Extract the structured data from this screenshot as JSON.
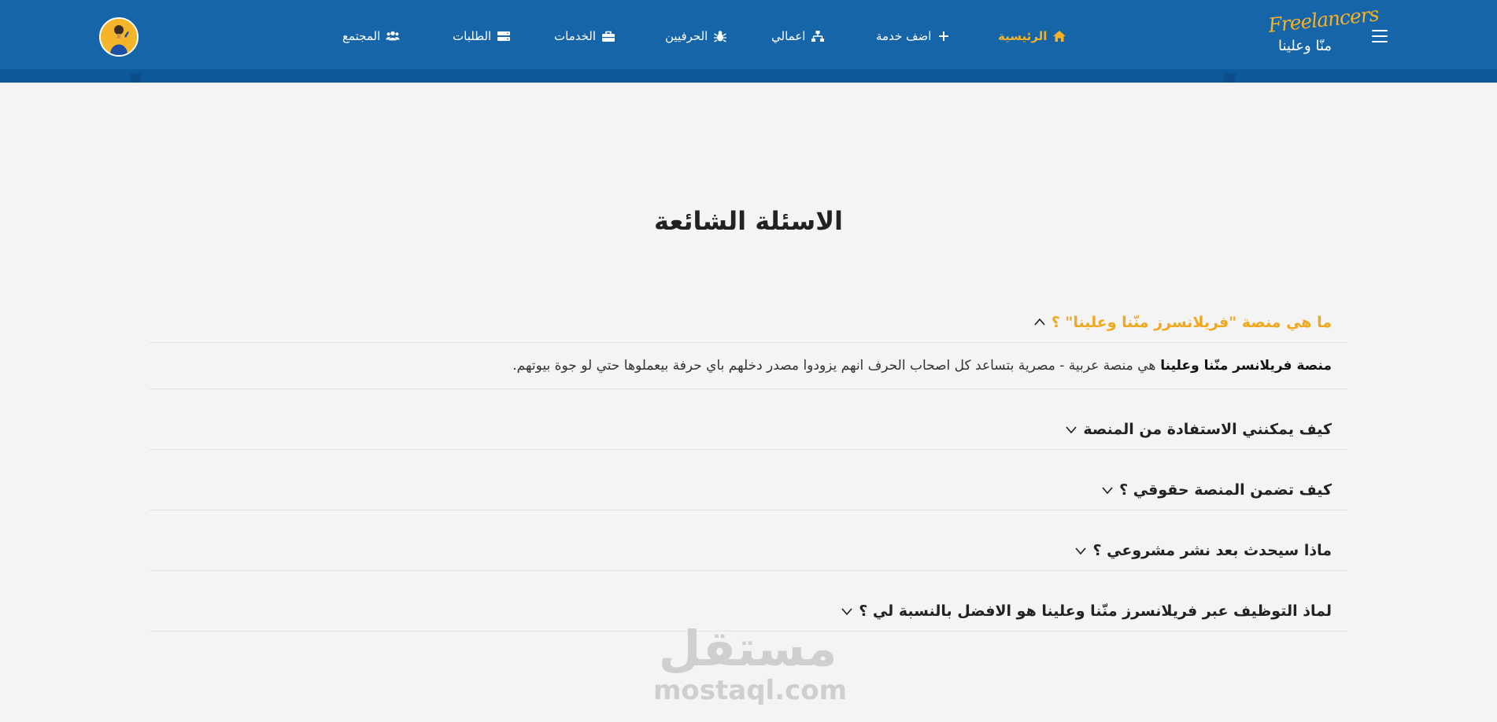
{
  "header": {
    "logo_script": "Freelancers",
    "logo_arabic": "منّا وعلينا",
    "nav": [
      {
        "label": "الرئيسية",
        "icon": "home-icon",
        "active": true
      },
      {
        "label": "اضف خدمة",
        "icon": "plus-icon"
      },
      {
        "label": "اعمالي",
        "icon": "sitemap-icon"
      },
      {
        "label": "الحرفيين",
        "icon": "bug-icon"
      },
      {
        "label": "الخدمات",
        "icon": "toolbox-icon"
      },
      {
        "label": "الطلبات",
        "icon": "server-icon"
      },
      {
        "label": "المجتمع",
        "icon": "users-icon"
      }
    ]
  },
  "page": {
    "title": "الاسئلة الشائعة"
  },
  "faq": [
    {
      "question": "ما هي منصة \"فريلانسرز منّنا وعلينا\" ؟",
      "open": true,
      "answer_bold": "منصة فريلانسر منّنا وعلينا",
      "answer_text": "هي منصة عربية - مصرية بتساعد كل اصحاب الحرف انهم يزودوا مصدر دخلهم باي حرفة بيعملوها حتي لو جوة بيوتهم."
    },
    {
      "question": "كيف يمكنني الاستفادة من المنصة",
      "open": false
    },
    {
      "question": "كيف تضمن المنصة حقوقي ؟",
      "open": false
    },
    {
      "question": "ماذا سيحدث بعد نشر مشروعي ؟",
      "open": false
    },
    {
      "question": "لماذ التوظيف عبر فريلانسرز منّنا وعلينا هو الافضل بالنسبة لي ؟",
      "open": false
    }
  ],
  "watermark": {
    "arabic": "مستقل",
    "latin": "mostaql.com"
  },
  "colors": {
    "header_bg": "#1565a8",
    "accent": "#f5b226",
    "faq_open": "#f0a81e",
    "page_bg": "#f4f4f4"
  }
}
